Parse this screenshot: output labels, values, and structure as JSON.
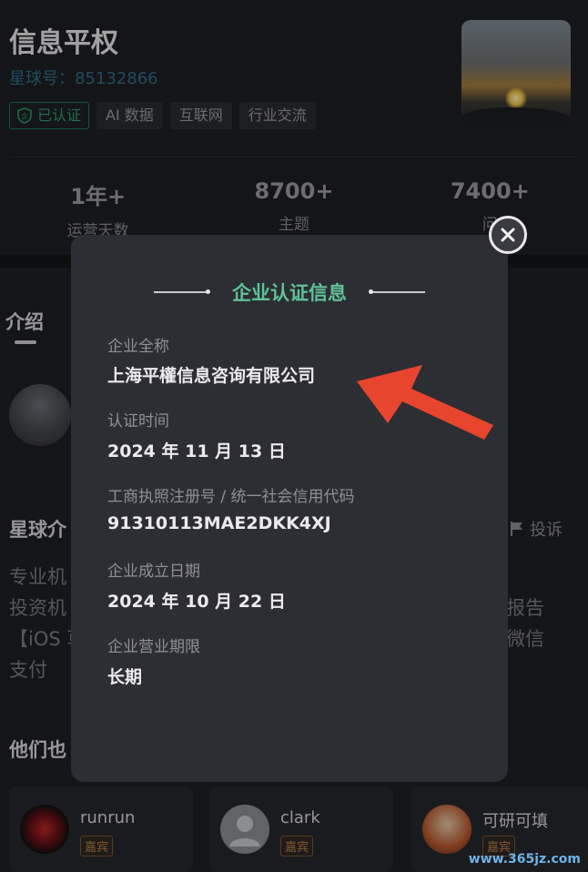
{
  "header": {
    "title": "信息平权",
    "planet_id": "星球号：85132866",
    "tags": [
      "已认证",
      "AI 数据",
      "互联网",
      "行业交流"
    ]
  },
  "stats": [
    {
      "value": "1年+",
      "label": "运营天数"
    },
    {
      "value": "8700+",
      "label": "主题"
    },
    {
      "value": "7400+",
      "label": "问"
    }
  ],
  "section": {
    "intro": "介绍",
    "planet_intro": "星球介",
    "report": "投诉",
    "desc_left": [
      "专业机",
      "投资机",
      "【iOS 草",
      "支付"
    ],
    "desc_right": [
      "报告",
      "微信"
    ],
    "others": "他们也"
  },
  "members": [
    {
      "name": "runrun",
      "badge": "嘉宾"
    },
    {
      "name": "clark",
      "badge": "嘉宾"
    },
    {
      "name": "可研可填",
      "badge": "嘉宾"
    }
  ],
  "modal": {
    "title": "企业认证信息",
    "fields": [
      {
        "label": "企业全称",
        "value": "上海平權信息咨询有限公司"
      },
      {
        "label": "认证时间",
        "value": "2024 年 11 月 13 日"
      },
      {
        "label": "工商执照注册号 / 统一社会信用代码",
        "value": "91310113MAE2DKK4XJ"
      },
      {
        "label": "企业成立日期",
        "value": "2024 年 10 月 22 日"
      },
      {
        "label": "企业营业期限",
        "value": "长期"
      }
    ]
  },
  "watermark": "www.365jz.com",
  "colors": {
    "accent_green": "#5fc29a",
    "annotation_arrow": "#e8452e",
    "planet_id_blue": "#2f6d86"
  }
}
